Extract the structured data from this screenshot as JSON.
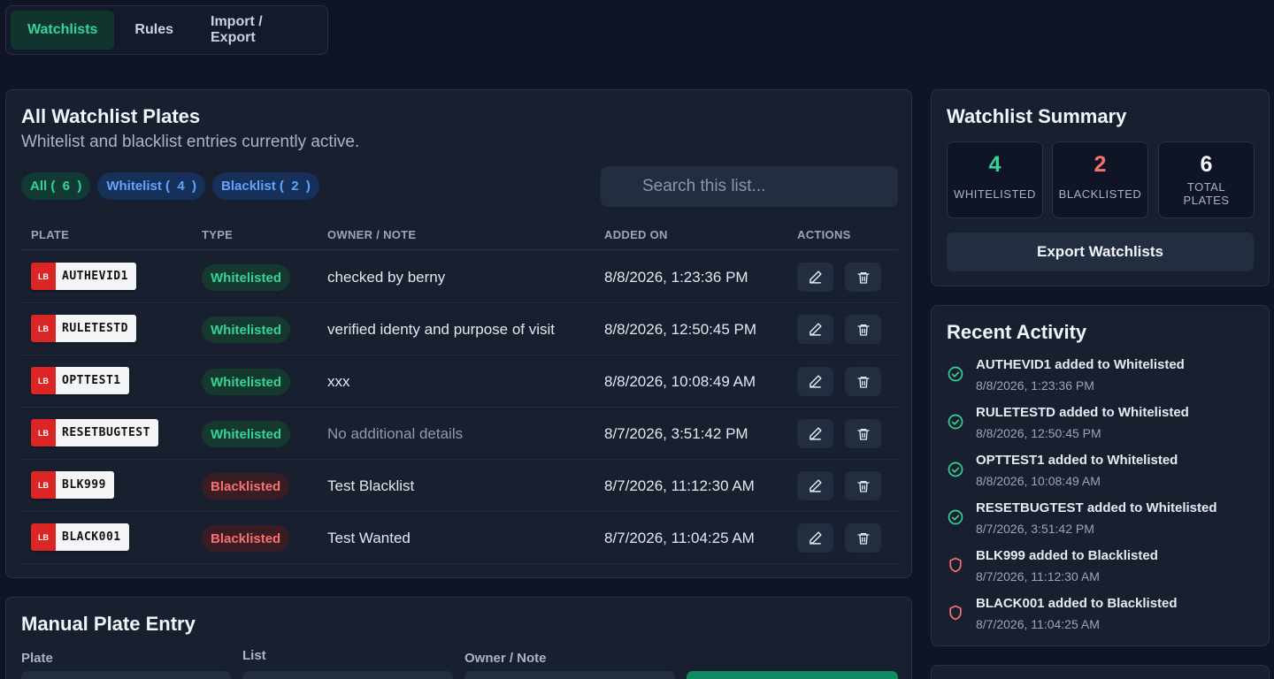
{
  "tabs": [
    {
      "label": "Watchlists",
      "active": true
    },
    {
      "label": "Rules",
      "active": false
    },
    {
      "label": "Import / Export",
      "active": false
    }
  ],
  "list": {
    "title": "All Watchlist Plates",
    "subtitle": "Whitelist and blacklist entries currently active.",
    "filters": {
      "all": "All (  6  )",
      "whitelist": "Whitelist (  4  )",
      "blacklist": "Blacklist (  2  )"
    },
    "search_placeholder": "Search this list...",
    "columns": [
      "PLATE",
      "TYPE",
      "OWNER / NOTE",
      "ADDED ON",
      "ACTIONS"
    ],
    "rows": [
      {
        "tag": "LB",
        "plate": "AUTHEVID1",
        "type": "Whitelisted",
        "kind": "white",
        "note": "checked by berny",
        "added": "8/8/2026, 1:23:36 PM"
      },
      {
        "tag": "LB",
        "plate": "RULETESTD",
        "type": "Whitelisted",
        "kind": "white",
        "note": "verified identy and purpose of visit",
        "added": "8/8/2026, 12:50:45 PM"
      },
      {
        "tag": "LB",
        "plate": "OPTTEST1",
        "type": "Whitelisted",
        "kind": "white",
        "note": "xxx",
        "added": "8/8/2026, 10:08:49 AM"
      },
      {
        "tag": "LB",
        "plate": "RESETBUGTEST",
        "type": "Whitelisted",
        "kind": "white",
        "note": "No additional details",
        "muted": true,
        "added": "8/7/2026, 3:51:42 PM"
      },
      {
        "tag": "LB",
        "plate": "BLK999",
        "type": "Blacklisted",
        "kind": "black",
        "note": "Test Blacklist",
        "added": "8/7/2026, 11:12:30 AM"
      },
      {
        "tag": "LB",
        "plate": "BLACK001",
        "type": "Blacklisted",
        "kind": "black",
        "note": "Test Wanted",
        "added": "8/7/2026, 11:04:25 AM"
      }
    ]
  },
  "manual": {
    "title": "Manual Plate Entry",
    "plate_label": "Plate",
    "list_label": "List",
    "owner_label": "Owner / Note"
  },
  "summary": {
    "title": "Watchlist Summary",
    "whitelisted_value": "4",
    "whitelisted_label": "WHITELISTED",
    "blacklisted_value": "2",
    "blacklisted_label": "BLACKLISTED",
    "total_value": "6",
    "total_label": "TOTAL PLATES",
    "export_label": "Export Watchlists"
  },
  "activity": {
    "title": "Recent Activity",
    "items": [
      {
        "text": "AUTHEVID1 added to Whitelisted",
        "time": "8/8/2026, 1:23:36 PM",
        "kind": "white",
        "icon": "check-circle-icon"
      },
      {
        "text": "RULETESTD added to Whitelisted",
        "time": "8/8/2026, 12:50:45 PM",
        "kind": "white",
        "icon": "check-circle-icon"
      },
      {
        "text": "OPTTEST1 added to Whitelisted",
        "time": "8/8/2026, 10:08:49 AM",
        "kind": "white",
        "icon": "check-circle-icon"
      },
      {
        "text": "RESETBUGTEST added to Whitelisted",
        "time": "8/7/2026, 3:51:42 PM",
        "kind": "white",
        "icon": "check-circle-icon"
      },
      {
        "text": "BLK999 added to Blacklisted",
        "time": "8/7/2026, 11:12:30 AM",
        "kind": "black",
        "icon": "shield-icon"
      },
      {
        "text": "BLACK001 added to Blacklisted",
        "time": "8/7/2026, 11:04:25 AM",
        "kind": "black",
        "icon": "shield-icon"
      }
    ]
  },
  "colors": {
    "background": "#0f1524",
    "panel": "#18202f",
    "accent_green": "#34d399",
    "accent_red": "#f87171",
    "accent_blue": "#60a5fa"
  },
  "icons": {
    "edit": "pencil-icon",
    "delete": "trash-icon",
    "search": "search-icon"
  }
}
